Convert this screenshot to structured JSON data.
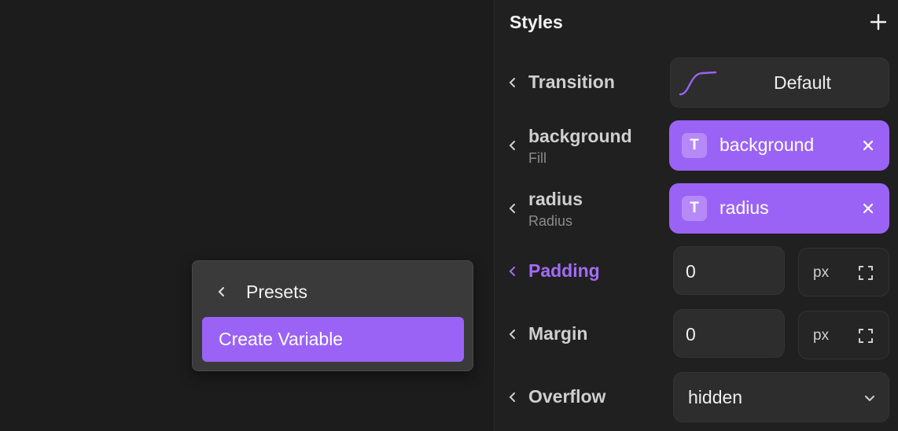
{
  "colors": {
    "accent": "#9a63f5",
    "accent_text": "#a26cf6",
    "panel_bg": "#202020",
    "canvas_bg": "#1c1c1c",
    "field_bg": "#2d2d2d"
  },
  "panel": {
    "title": "Styles",
    "add_icon": "plus-icon"
  },
  "transition": {
    "label": "Transition",
    "value": "Default",
    "icon": "easing-curve-icon"
  },
  "background": {
    "label": "background",
    "sublabel": "Fill",
    "token_badge": "T",
    "token_value": "background"
  },
  "radius": {
    "label": "radius",
    "sublabel": "Radius",
    "token_badge": "T",
    "token_value": "radius"
  },
  "padding": {
    "label": "Padding",
    "value": "0",
    "unit": "px",
    "expand_icon": "expand-corners-icon"
  },
  "margin": {
    "label": "Margin",
    "value": "0",
    "unit": "px",
    "expand_icon": "expand-corners-icon"
  },
  "overflow": {
    "label": "Overflow",
    "value": "hidden",
    "dropdown_icon": "chevron-down-icon"
  },
  "popover": {
    "header": "Presets",
    "item": "Create Variable"
  }
}
